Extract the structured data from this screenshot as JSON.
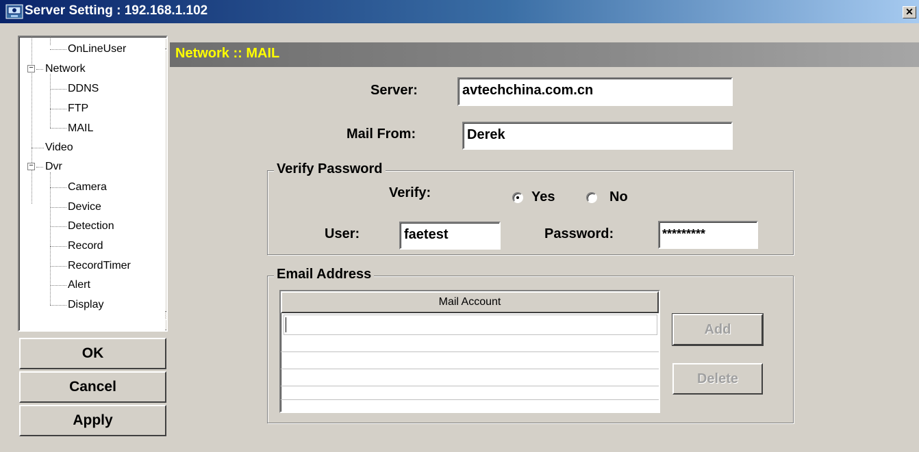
{
  "window": {
    "title": "Server Setting : 192.168.1.102",
    "close_glyph": "✕",
    "icon": "dvr-app-icon"
  },
  "tree": {
    "items": [
      {
        "label": "OnLineUser",
        "level": 2
      },
      {
        "label": "Network",
        "level": 1,
        "expanded": true
      },
      {
        "label": "DDNS",
        "level": 2
      },
      {
        "label": "FTP",
        "level": 2
      },
      {
        "label": "MAIL",
        "level": 2,
        "selected": true
      },
      {
        "label": "Video",
        "level": 1
      },
      {
        "label": "Dvr",
        "level": 1,
        "expanded": true
      },
      {
        "label": "Camera",
        "level": 2
      },
      {
        "label": "Device",
        "level": 2
      },
      {
        "label": "Detection",
        "level": 2
      },
      {
        "label": "Record",
        "level": 2
      },
      {
        "label": "RecordTimer",
        "level": 2
      },
      {
        "label": "Alert",
        "level": 2
      },
      {
        "label": "Display",
        "level": 2
      }
    ],
    "expander_glyph": "−",
    "scroll_up_glyph": "▲",
    "scroll_down_glyph": "▼"
  },
  "buttons": {
    "ok": "OK",
    "cancel": "Cancel",
    "apply": "Apply"
  },
  "header": {
    "title": "Network :: MAIL",
    "color": "#ffff00"
  },
  "form": {
    "server_label": "Server:",
    "server_value": "avtechchina.com.cn",
    "mail_from_label": "Mail From:",
    "mail_from_value": "Derek"
  },
  "verify_password": {
    "group_title": "Verify Password",
    "verify_label": "Verify:",
    "yes_label": "Yes",
    "no_label": "No",
    "selected": "Yes",
    "user_label": "User:",
    "user_value": "faetest",
    "password_label": "Password:",
    "password_value": "*********"
  },
  "email_address": {
    "group_title": "Email Address",
    "column_header": "Mail Account",
    "rows": [],
    "add_label": "Add",
    "delete_label": "Delete"
  }
}
